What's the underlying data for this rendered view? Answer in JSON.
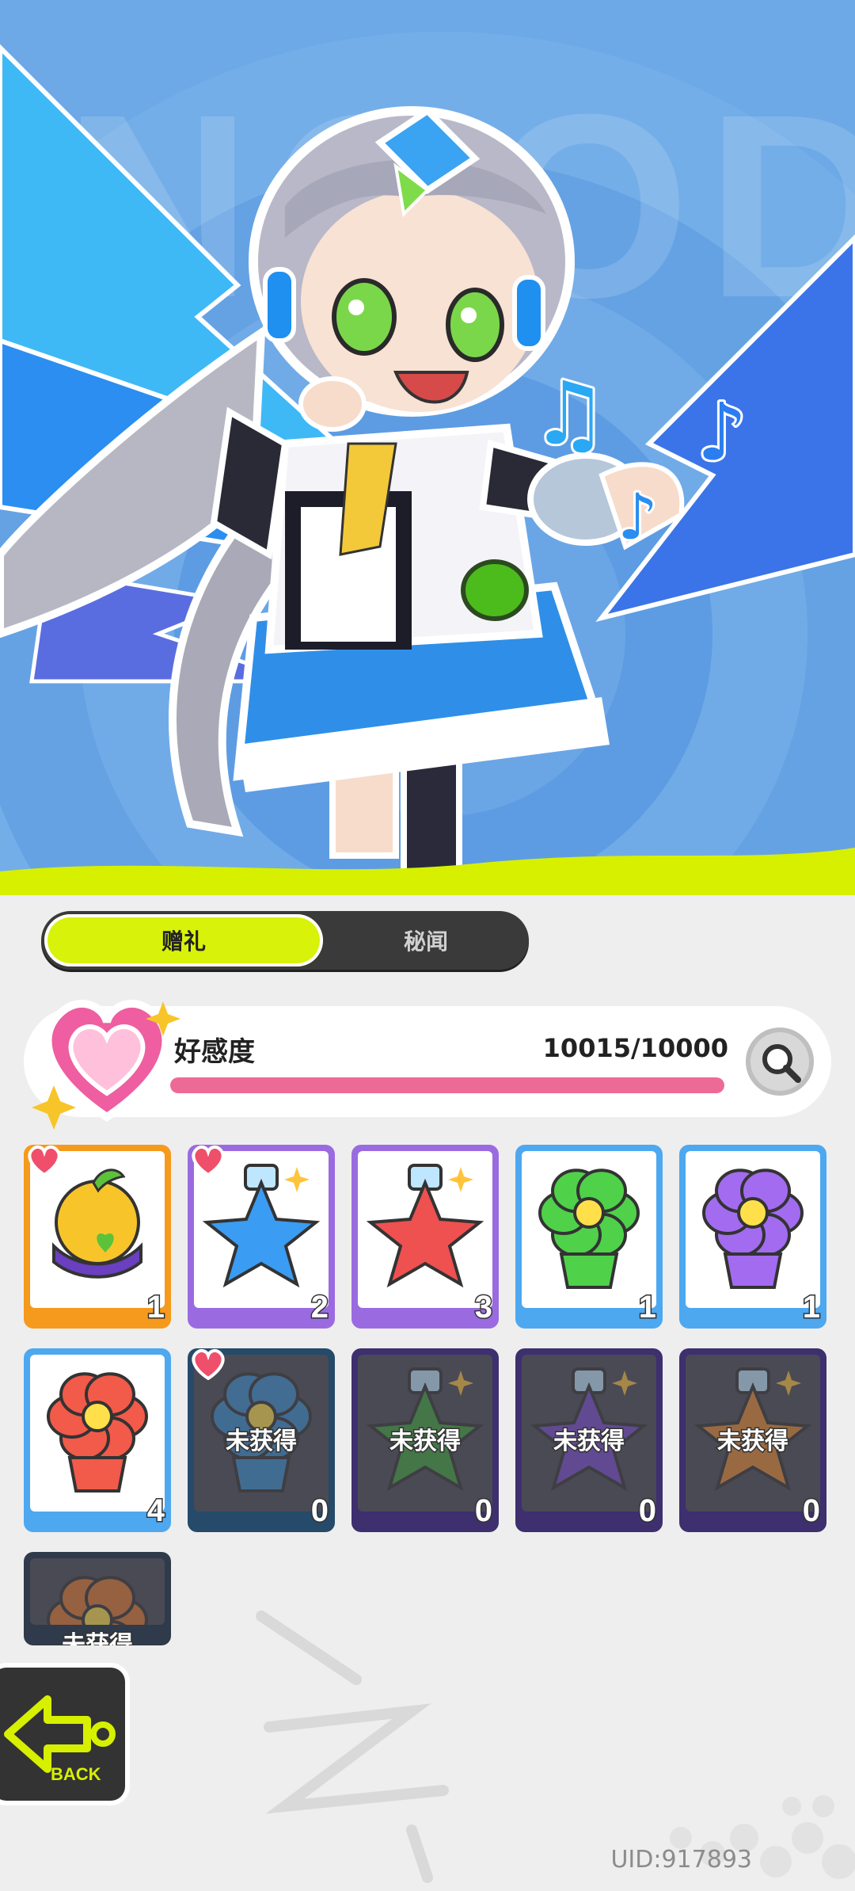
{
  "hero": {
    "background_word": "NOOD"
  },
  "tabs": [
    {
      "label": "赠礼",
      "active": true
    },
    {
      "label": "秘闻",
      "active": false
    }
  ],
  "affection": {
    "label": "好感度",
    "current": 10015,
    "max": 10000,
    "value_text": "10015/10000",
    "progress": 1.0
  },
  "gifts": [
    {
      "count": "1",
      "favorite": true,
      "frame": "orange",
      "art": "golden-apple",
      "locked": false
    },
    {
      "count": "2",
      "favorite": true,
      "frame": "purple",
      "art": "blue-star-bottle",
      "locked": false
    },
    {
      "count": "3",
      "favorite": false,
      "frame": "purple",
      "art": "red-star-bottle",
      "locked": false
    },
    {
      "count": "1",
      "favorite": false,
      "frame": "blue",
      "art": "green-flower-pot",
      "locked": false
    },
    {
      "count": "1",
      "favorite": false,
      "frame": "blue",
      "art": "purple-flower-pot",
      "locked": false
    },
    {
      "count": "4",
      "favorite": false,
      "frame": "blue",
      "art": "red-flower-pot",
      "locked": false
    },
    {
      "count": "0",
      "favorite": true,
      "frame": "navy",
      "art": "blue-flower-pot",
      "locked": true,
      "lock_label": "未获得"
    },
    {
      "count": "0",
      "favorite": false,
      "frame": "dkpurple",
      "art": "green-star-bottle",
      "locked": true,
      "lock_label": "未获得"
    },
    {
      "count": "0",
      "favorite": false,
      "frame": "dkpurple",
      "art": "purple-star-bottle",
      "locked": true,
      "lock_label": "未获得"
    },
    {
      "count": "0",
      "favorite": false,
      "frame": "dkpurple",
      "art": "orange-star-bottle",
      "locked": true,
      "lock_label": "未获得"
    },
    {
      "count": "",
      "favorite": false,
      "frame": "dkgray",
      "art": "orange-flower-pot",
      "locked": true,
      "lock_label": "未获得"
    }
  ],
  "back_button": {
    "label": "BACK"
  },
  "uid": "UID:917893",
  "colors": {
    "accent": "#d8f20a",
    "affection_bar": "#ee6a96",
    "hero_blue": "#6aa6e6"
  }
}
